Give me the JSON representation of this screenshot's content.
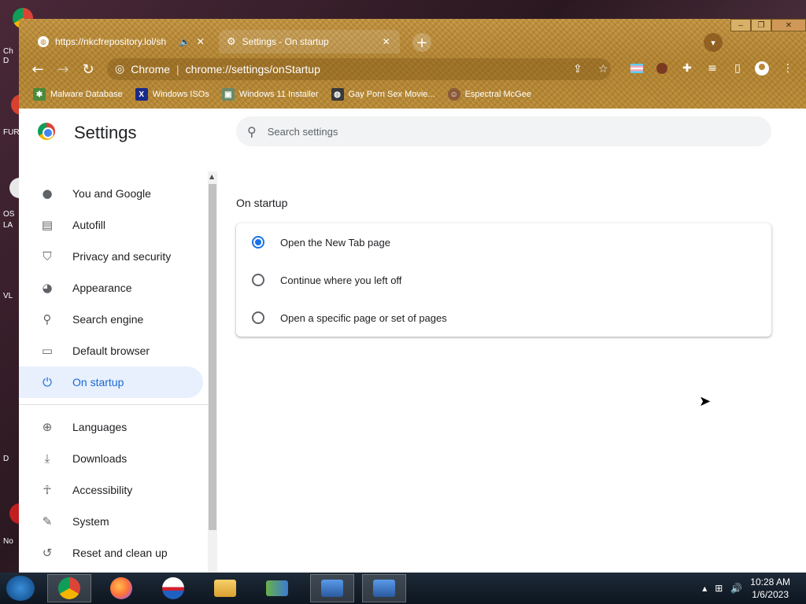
{
  "desktop": {
    "labels": [
      "Ch",
      "D",
      "FUR",
      "OS",
      "LA",
      "VL",
      "D",
      "No"
    ]
  },
  "tabs": [
    {
      "title": "https://nkcfrepository.lol/sh",
      "favicon": "globe-icon",
      "audio": "speaker-icon"
    },
    {
      "title": "Settings - On startup",
      "favicon": "gear-icon"
    }
  ],
  "toolbar": {
    "site_chip": "Chrome",
    "separator": "|",
    "url": "chrome://settings/onStartup"
  },
  "bookmarks": [
    {
      "label": "Malware Database",
      "icon": "bug-icon",
      "color": "#4a8a3a"
    },
    {
      "label": "Windows ISOs",
      "icon": "x-icon",
      "color": "#1a2a8a"
    },
    {
      "label": "Windows 11 Installer",
      "icon": "image-icon",
      "color": "#6a8a6a"
    },
    {
      "label": "Gay Porn Sex Movie...",
      "icon": "globe-icon",
      "color": "#3a3a3a"
    },
    {
      "label": "Espectral McGee",
      "icon": "face-icon",
      "color": "#8a5a3a"
    }
  ],
  "settings": {
    "title": "Settings",
    "search_placeholder": "Search settings",
    "nav": [
      {
        "label": "You and Google",
        "icon": "person-icon",
        "glyph": "👤"
      },
      {
        "label": "Autofill",
        "icon": "clipboard-icon",
        "glyph": "📋"
      },
      {
        "label": "Privacy and security",
        "icon": "shield-icon",
        "glyph": "⛊"
      },
      {
        "label": "Appearance",
        "icon": "palette-icon",
        "glyph": "🎨"
      },
      {
        "label": "Search engine",
        "icon": "search-icon",
        "glyph": "🔍"
      },
      {
        "label": "Default browser",
        "icon": "browser-icon",
        "glyph": "▭"
      },
      {
        "label": "On startup",
        "icon": "power-icon",
        "glyph": "⏻"
      },
      {
        "label": "Languages",
        "icon": "globe-icon",
        "glyph": "🌐"
      },
      {
        "label": "Downloads",
        "icon": "download-icon",
        "glyph": "⤓"
      },
      {
        "label": "Accessibility",
        "icon": "accessibility-icon",
        "glyph": "♿"
      },
      {
        "label": "System",
        "icon": "wrench-icon",
        "glyph": "🔧"
      },
      {
        "label": "Reset and clean up",
        "icon": "history-icon",
        "glyph": "↺"
      }
    ],
    "active_nav": "On startup",
    "section_title": "On startup",
    "startup_options": [
      {
        "label": "Open the New Tab page",
        "checked": true
      },
      {
        "label": "Continue where you left off",
        "checked": false
      },
      {
        "label": "Open a specific page or set of pages",
        "checked": false
      }
    ]
  },
  "taskbar": {
    "time": "10:28 AM",
    "date": "1/6/2023"
  },
  "colors": {
    "accent": "#1a73e8",
    "active_nav_bg": "#e8f0fe",
    "chrome_theme": "#c89a48"
  }
}
